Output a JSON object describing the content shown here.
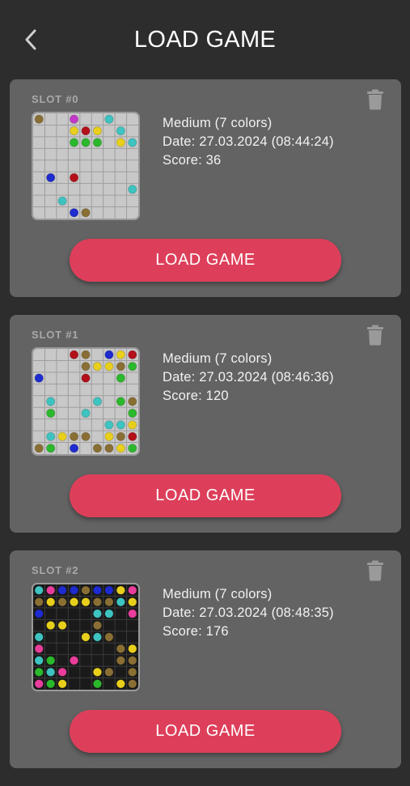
{
  "header": {
    "title": "LOAD GAME",
    "back_icon": "chevron-left-icon"
  },
  "colors": {
    "background": "#2d2d2d",
    "card": "#636363",
    "button": "#dd3f5a",
    "board_light": "#c8c8c8",
    "board_dark": "#1a1a1a"
  },
  "ball_colors": {
    "O": "#8a6f34",
    "M": "#c236c8",
    "R": "#b3101a",
    "Y": "#e8cf1c",
    "G": "#2bb82c",
    "C": "#3ec3c0",
    "B": "#1d2bcf",
    "P": "#e93d9b"
  },
  "slots": [
    {
      "label": "SLOT #0",
      "difficulty": "Medium (7 colors)",
      "date": "Date: 27.03.2024 (08:44:24)",
      "score": "Score: 36",
      "button_label": "LOAD GAME",
      "board_theme": "light",
      "board": [
        "O..M..C..",
        "...YRY.C.",
        "...GGG.YC",
        ".........",
        "..,......",
        ".B.R.....",
        "........C",
        "..C......",
        "...BO...."
      ]
    },
    {
      "label": "SLOT #1",
      "difficulty": "Medium (7 colors)",
      "date": "Date: 27.03.2024 (08:46:36)",
      "score": "Score: 120",
      "button_label": "LOAD GAME",
      "board_theme": "light",
      "board": [
        "...RO.BYR",
        "....OYYOG",
        "B...R..G.",
        ".........",
        ".C...C.GO",
        ".G..C...G",
        "......CCY",
        ".CYOO.YOR",
        "OG.B.OOYG"
      ]
    },
    {
      "label": "SLOT #2",
      "difficulty": "Medium (7 colors)",
      "date": "Date: 27.03.2024 (08:48:35)",
      "score": "Score: 176",
      "button_label": "LOAD GAME",
      "board_theme": "dark",
      "board": [
        "CPBBOBBYP",
        "OYOYYOOCY",
        "B....CC.P",
        ".YY..O...",
        "C...YCO..",
        "P......OY",
        "CG.P...OO",
        "GCP..YO.O",
        "PGY..G.YO"
      ]
    }
  ]
}
